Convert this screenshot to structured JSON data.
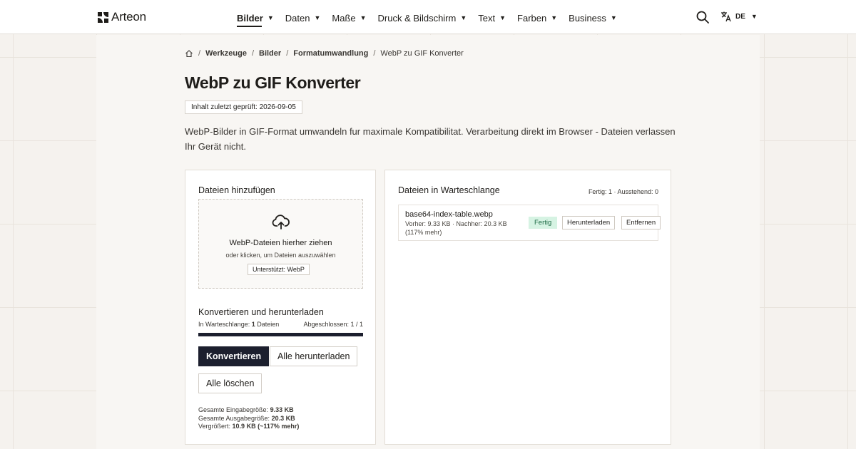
{
  "header": {
    "brand": "Arteon",
    "nav": [
      {
        "label": "Bilder",
        "active": true
      },
      {
        "label": "Daten"
      },
      {
        "label": "Maße"
      },
      {
        "label": "Druck & Bildschirm"
      },
      {
        "label": "Text"
      },
      {
        "label": "Farben"
      },
      {
        "label": "Business"
      }
    ],
    "caret": "▼",
    "language": "DE"
  },
  "breadcrumb": {
    "sep": "/",
    "items": [
      "Werkzeuge",
      "Bilder",
      "Formatumwandlung",
      "WebP zu GIF Konverter"
    ]
  },
  "page": {
    "title": "WebP zu GIF Konverter",
    "reviewed": "Inhalt zuletzt geprüft: 2026-09-05",
    "description": "WebP-Bilder in GIF-Format umwandeln fur maximale Kompatibilitat. Verarbeitung direkt im Browser - Dateien verlassen Ihr Gerät nicht."
  },
  "upload": {
    "heading": "Dateien hinzufügen",
    "drop_title": "WebP-Dateien hierher ziehen",
    "drop_sub": "oder klicken, um Dateien auszuwählen",
    "supported": "Unterstützt: WebP"
  },
  "convert": {
    "heading": "Konvertieren und herunterladen",
    "queue_label": "In Warteschlange:",
    "queue_count": "1",
    "queue_unit": "Dateien",
    "done_label": "Abgeschlossen: 1 / 1",
    "progress": 1.0,
    "btn_convert": "Konvertieren",
    "btn_download_all": "Alle herunterladen",
    "btn_clear": "Alle löschen",
    "totals": {
      "in_label": "Gesamte Eingabegröße:",
      "in_value": "9.33 KB",
      "out_label": "Gesamte Ausgabegröße:",
      "out_value": "20.3 KB",
      "diff_label": "Vergrößert:",
      "diff_value": "10.9 KB (~117% mehr)"
    }
  },
  "queue": {
    "heading": "Dateien in Warteschlange",
    "status": "Fertig: 1 · Ausstehend: 0",
    "files": [
      {
        "name": "base64-index-table.webp",
        "meta": "Vorher: 9.33 KB · Nachher: 20.3 KB (117% mehr)",
        "state": "Fertig",
        "download": "Herunterladen",
        "remove": "Entfernen"
      }
    ]
  },
  "colors": {
    "primary": "#1c1f2e",
    "done_bg": "#d6f3e3",
    "done_fg": "#1e6b45",
    "page_bg": "#f5f2ee"
  }
}
